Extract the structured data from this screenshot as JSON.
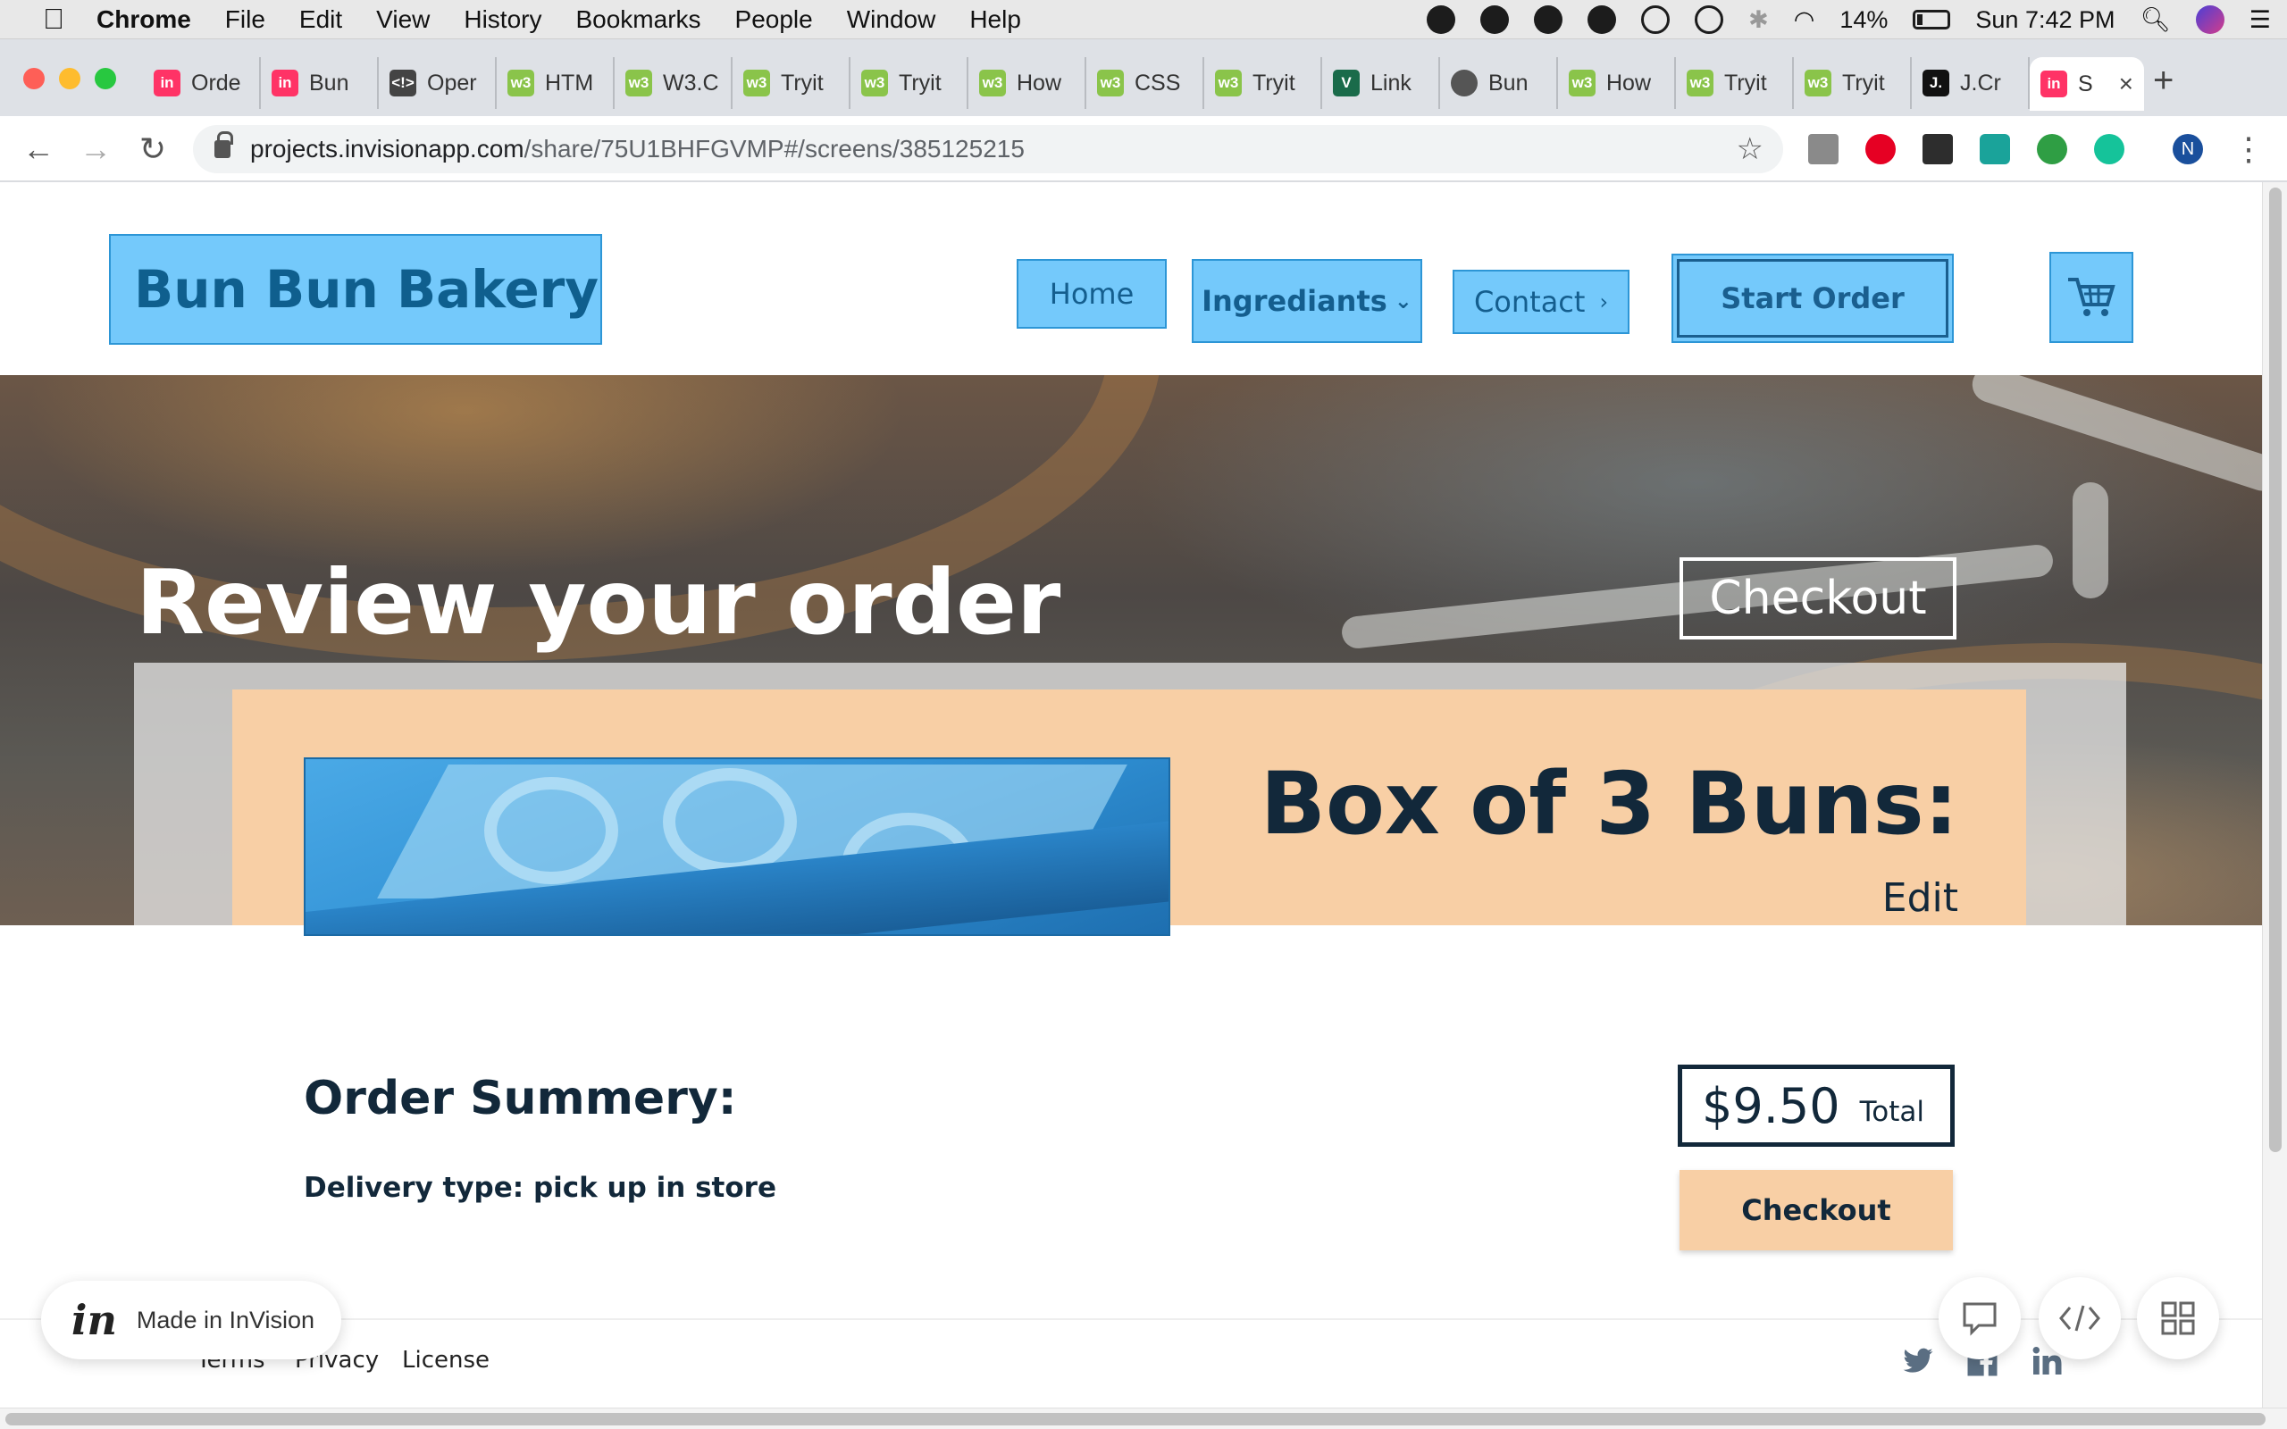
{
  "menubar": {
    "app_name": "Chrome",
    "items": [
      "File",
      "Edit",
      "View",
      "History",
      "Bookmarks",
      "People",
      "Window",
      "Help"
    ],
    "battery_text": "14%",
    "clock": "Sun 7:42 PM"
  },
  "browser": {
    "tabs": [
      {
        "label": "Orde",
        "icon": "invision-icon"
      },
      {
        "label": "Bun",
        "icon": "invision-icon"
      },
      {
        "label": "Oper",
        "icon": "code-icon"
      },
      {
        "label": "HTM",
        "icon": "w3schools-icon"
      },
      {
        "label": "W3.C",
        "icon": "w3schools-icon"
      },
      {
        "label": "Tryit",
        "icon": "w3schools-icon"
      },
      {
        "label": "Tryit",
        "icon": "w3schools-icon"
      },
      {
        "label": "How",
        "icon": "w3schools-icon"
      },
      {
        "label": "CSS",
        "icon": "w3schools-icon"
      },
      {
        "label": "Tryit",
        "icon": "w3schools-icon"
      },
      {
        "label": "Link",
        "icon": "vuetify-icon"
      },
      {
        "label": "Bun",
        "icon": "globe-icon"
      },
      {
        "label": "How",
        "icon": "w3schools-icon"
      },
      {
        "label": "Tryit",
        "icon": "w3schools-icon"
      },
      {
        "label": "Tryit",
        "icon": "w3schools-icon"
      },
      {
        "label": "J.Cr",
        "icon": "jcrew-icon"
      }
    ],
    "active_tab": {
      "label": "S",
      "icon": "invision-icon"
    },
    "url_host": "projects.invisionapp.com",
    "url_path": "/share/75U1BHFGVMP#/screens/385125215",
    "profile_initial": "N"
  },
  "site": {
    "logo": "Bun Bun Bakery",
    "nav": {
      "home": "Home",
      "ingredients": "Ingrediants",
      "contact": "Contact",
      "start_order": "Start Order"
    },
    "hero": {
      "title": "Review your order",
      "checkout": "Checkout"
    },
    "order_item": {
      "title": "Box of 3 Buns:",
      "edit": "Edit"
    },
    "summary": {
      "title": "Order Summery:",
      "delivery": "Delivery type: pick up in store",
      "total_amount": "$9.50",
      "total_label": "Total",
      "checkout": "Checkout"
    },
    "footer": {
      "links": [
        "Terms",
        "Privacy",
        "License"
      ],
      "social": [
        "twitter-icon",
        "facebook-icon",
        "linkedin-icon"
      ]
    }
  },
  "invision": {
    "badge_logo": "in",
    "badge_text": "Made in InVision"
  },
  "colors": {
    "nav_blue": "#74c9fb",
    "nav_border": "#2d96d6",
    "text_dark": "#12283a",
    "peach": "#f8cfa5"
  }
}
